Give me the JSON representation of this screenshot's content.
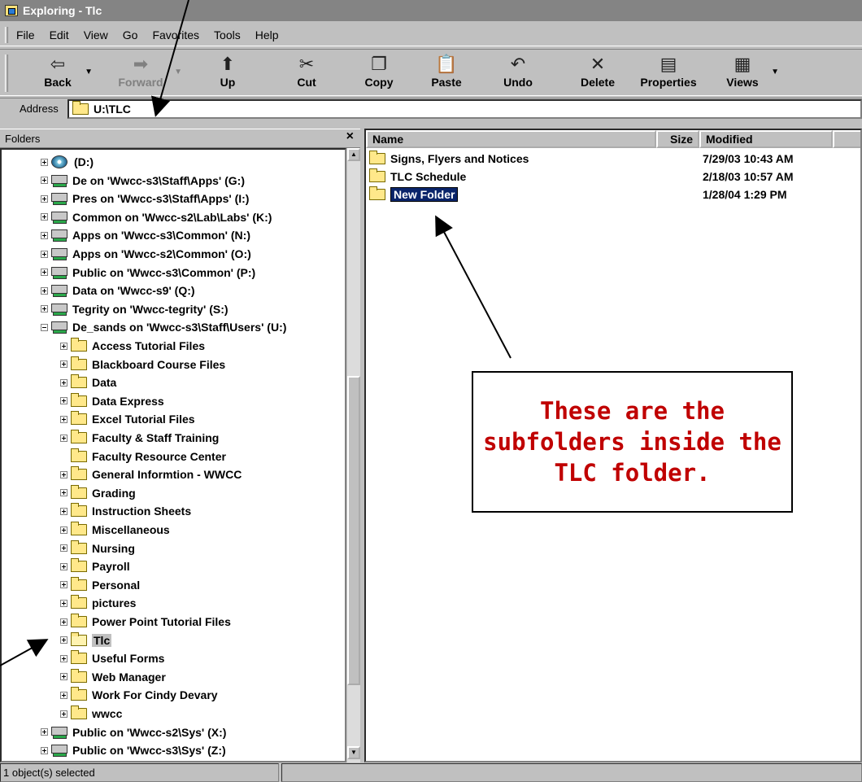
{
  "window": {
    "title": "Exploring - Tlc"
  },
  "menu": [
    "File",
    "Edit",
    "View",
    "Go",
    "Favorites",
    "Tools",
    "Help"
  ],
  "toolbar": {
    "back": "Back",
    "forward": "Forward",
    "up": "Up",
    "cut": "Cut",
    "copy": "Copy",
    "paste": "Paste",
    "undo": "Undo",
    "delete": "Delete",
    "properties": "Properties",
    "views": "Views"
  },
  "address": {
    "label": "Address",
    "value": "U:\\TLC"
  },
  "folders_pane": {
    "title": "Folders",
    "close": "×"
  },
  "tree": [
    {
      "label": "(D:)",
      "type": "cd",
      "level": 1,
      "toggle": "plus"
    },
    {
      "label": "De on 'Wwcc-s3\\Staff\\Apps' (G:)",
      "type": "drive",
      "level": 1,
      "toggle": "plus"
    },
    {
      "label": "Pres on 'Wwcc-s3\\Staff\\Apps' (I:)",
      "type": "drive",
      "level": 1,
      "toggle": "plus"
    },
    {
      "label": "Common on 'Wwcc-s2\\Lab\\Labs' (K:)",
      "type": "drive",
      "level": 1,
      "toggle": "plus"
    },
    {
      "label": "Apps on 'Wwcc-s3\\Common' (N:)",
      "type": "drive",
      "level": 1,
      "toggle": "plus"
    },
    {
      "label": "Apps on 'Wwcc-s2\\Common' (O:)",
      "type": "drive",
      "level": 1,
      "toggle": "plus"
    },
    {
      "label": "Public on 'Wwcc-s3\\Common' (P:)",
      "type": "drive",
      "level": 1,
      "toggle": "plus"
    },
    {
      "label": "Data on 'Wwcc-s9' (Q:)",
      "type": "drive",
      "level": 1,
      "toggle": "plus"
    },
    {
      "label": "Tegrity on 'Wwcc-tegrity' (S:)",
      "type": "drive",
      "level": 1,
      "toggle": "plus"
    },
    {
      "label": "De_sands on 'Wwcc-s3\\Staff\\Users' (U:)",
      "type": "drive",
      "level": 1,
      "toggle": "minus"
    },
    {
      "label": "Access Tutorial Files",
      "type": "folder",
      "level": 2,
      "toggle": "plus"
    },
    {
      "label": "Blackboard Course Files",
      "type": "folder",
      "level": 2,
      "toggle": "plus"
    },
    {
      "label": "Data",
      "type": "folder",
      "level": 2,
      "toggle": "plus"
    },
    {
      "label": "Data Express",
      "type": "folder",
      "level": 2,
      "toggle": "plus"
    },
    {
      "label": "Excel Tutorial Files",
      "type": "folder",
      "level": 2,
      "toggle": "plus"
    },
    {
      "label": "Faculty & Staff Training",
      "type": "folder",
      "level": 2,
      "toggle": "plus"
    },
    {
      "label": "Faculty Resource Center",
      "type": "folder",
      "level": 2,
      "toggle": "none"
    },
    {
      "label": "General Informtion - WWCC",
      "type": "folder",
      "level": 2,
      "toggle": "plus"
    },
    {
      "label": "Grading",
      "type": "folder",
      "level": 2,
      "toggle": "plus"
    },
    {
      "label": "Instruction Sheets",
      "type": "folder",
      "level": 2,
      "toggle": "plus"
    },
    {
      "label": "Miscellaneous",
      "type": "folder",
      "level": 2,
      "toggle": "plus"
    },
    {
      "label": "Nursing",
      "type": "folder",
      "level": 2,
      "toggle": "plus"
    },
    {
      "label": "Payroll",
      "type": "folder",
      "level": 2,
      "toggle": "plus"
    },
    {
      "label": "Personal",
      "type": "folder",
      "level": 2,
      "toggle": "plus"
    },
    {
      "label": "pictures",
      "type": "folder",
      "level": 2,
      "toggle": "plus"
    },
    {
      "label": "Power Point Tutorial Files",
      "type": "folder",
      "level": 2,
      "toggle": "plus"
    },
    {
      "label": "Tlc",
      "type": "folder-open",
      "level": 2,
      "toggle": "plus",
      "selected": true
    },
    {
      "label": "Useful Forms",
      "type": "folder",
      "level": 2,
      "toggle": "plus"
    },
    {
      "label": "Web Manager",
      "type": "folder",
      "level": 2,
      "toggle": "plus"
    },
    {
      "label": "Work For Cindy Devary",
      "type": "folder",
      "level": 2,
      "toggle": "plus"
    },
    {
      "label": "wwcc",
      "type": "folder",
      "level": 2,
      "toggle": "plus"
    },
    {
      "label": "Public on 'Wwcc-s2\\Sys' (X:)",
      "type": "drive",
      "level": 1,
      "toggle": "plus"
    },
    {
      "label": "Public on 'Wwcc-s3\\Sys' (Z:)",
      "type": "drive",
      "level": 1,
      "toggle": "plus"
    }
  ],
  "list": {
    "columns": {
      "name": "Name",
      "size": "Size",
      "modified": "Modified"
    },
    "rows": [
      {
        "name": "Signs, Flyers and Notices",
        "modified": "7/29/03 10:43 AM"
      },
      {
        "name": "TLC Schedule",
        "modified": "2/18/03 10:57 AM"
      },
      {
        "name": "New Folder",
        "modified": "1/28/04 1:29 PM",
        "editing": true
      }
    ]
  },
  "status": {
    "text": "1 object(s) selected"
  },
  "callout": {
    "text": "These are the subfolders inside the TLC folder."
  }
}
